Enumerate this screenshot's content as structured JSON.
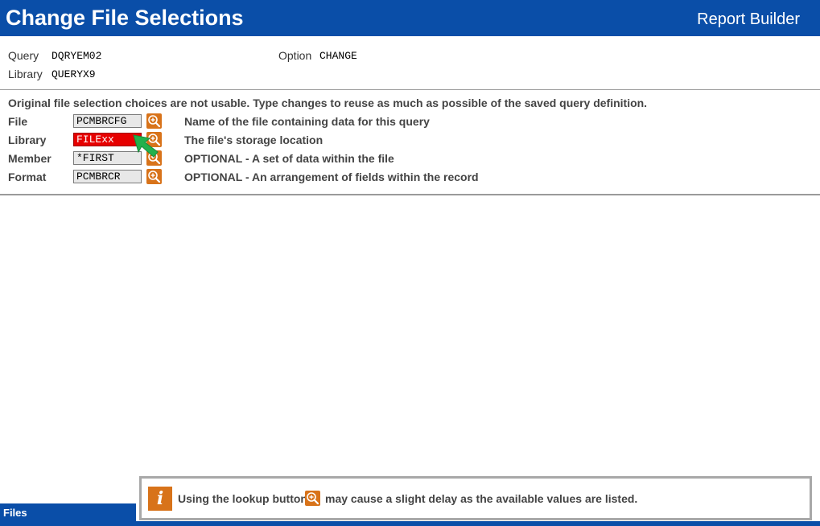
{
  "header": {
    "title": "Change File Selections",
    "app_name": "Report Builder"
  },
  "query_info": {
    "query_label": "Query",
    "query_value": "DQRYEM02",
    "library_label": "Library",
    "library_value": "QUERYX9",
    "option_label": "Option",
    "option_value": "CHANGE"
  },
  "message": "Original file selection choices are not usable. Type changes to reuse as much as possible of the saved query definition.",
  "fields": [
    {
      "label": "File",
      "value": "PCMBRCFG",
      "description": "Name of the file containing data for this query",
      "error": false
    },
    {
      "label": "Library",
      "value": "FILExx",
      "description": "The file's storage location",
      "error": true
    },
    {
      "label": "Member",
      "value": "*FIRST",
      "description": "OPTIONAL - A set of data within the file",
      "error": false
    },
    {
      "label": "Format",
      "value": "PCMBRCR",
      "description": "OPTIONAL - An arrangement of fields within the record",
      "error": false
    }
  ],
  "footer": {
    "tab_label": "Files"
  },
  "info_bar": {
    "text_before": "Using the lookup button",
    "text_after": "may cause a slight delay as the available values are listed."
  },
  "colors": {
    "header_blue": "#0a4ea8",
    "lookup_orange": "#d8731a",
    "error_red": "#e60000",
    "cursor_green": "#22b14c"
  },
  "icons": {
    "lookup": "magnifier-plus-icon",
    "info": "info-icon",
    "cursor": "mouse-cursor-icon"
  }
}
